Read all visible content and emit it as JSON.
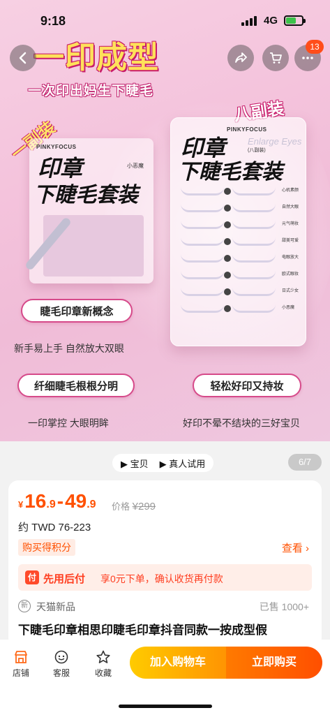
{
  "status_bar": {
    "time": "9:18",
    "network": "4G"
  },
  "hero": {
    "headline": "一印成型",
    "subline": "一次印出妈生下睫毛",
    "tag_one_pair": "一副装",
    "tag_eight_pairs": "八副装",
    "brand": "PINKYFOCUS",
    "box_title_line1": "印章",
    "box_title_line2": "下睫毛套装",
    "small_label": "小恶魔",
    "enlarge_text": "Enlarge Eyes",
    "pairs_text": "(八副装)",
    "styles": [
      "心机素颜",
      "自然大眼",
      "元气萌妆",
      "甜美可爱",
      "电眼放大",
      "欧式眼妆",
      "日式少女",
      "小恶魔"
    ],
    "feature1_pill": "睫毛印章新概念",
    "feature1_caption": "新手易上手 自然放大双眼",
    "feature2_pill": "纤细睫毛根根分明",
    "feature2_caption": "一印掌控 大眼明眸",
    "feature3_pill": "轻松好印又持妆",
    "feature3_caption": "好印不晕不结块的三好宝贝",
    "cart_badge": "13"
  },
  "media_tabs": [
    "▶ 宝贝",
    "▶ 真人试用"
  ],
  "page_count": "6/7",
  "price": {
    "currency": "¥",
    "low_int": "16",
    "low_dec": ".9",
    "dash": "-",
    "high_int": "49",
    "high_dec": ".9",
    "orig_label": "价格",
    "orig_value": "¥299",
    "twd": "约 TWD 76-223"
  },
  "points": {
    "tag": "购买得积分",
    "link": "查看 ›"
  },
  "pay_later": {
    "icon": "付",
    "title": "先用后付",
    "desc": "享0元下单，确认收货再付款"
  },
  "shop": {
    "new_icon": "新",
    "name": "天猫新品",
    "sold": "已售 1000+"
  },
  "product_title": "下睫毛印章相思印睫毛印章抖音同款一按成型假",
  "bottom_nav": {
    "store": "店铺",
    "service": "客服",
    "favorite": "收藏"
  },
  "buttons": {
    "add_cart": "加入购物车",
    "buy_now": "立即购买"
  },
  "colors": {
    "accent": "#ff5000",
    "pink_bg": "#f4c3dc",
    "cart_button": "#ffb000",
    "buy_button": "#ff5a00"
  }
}
